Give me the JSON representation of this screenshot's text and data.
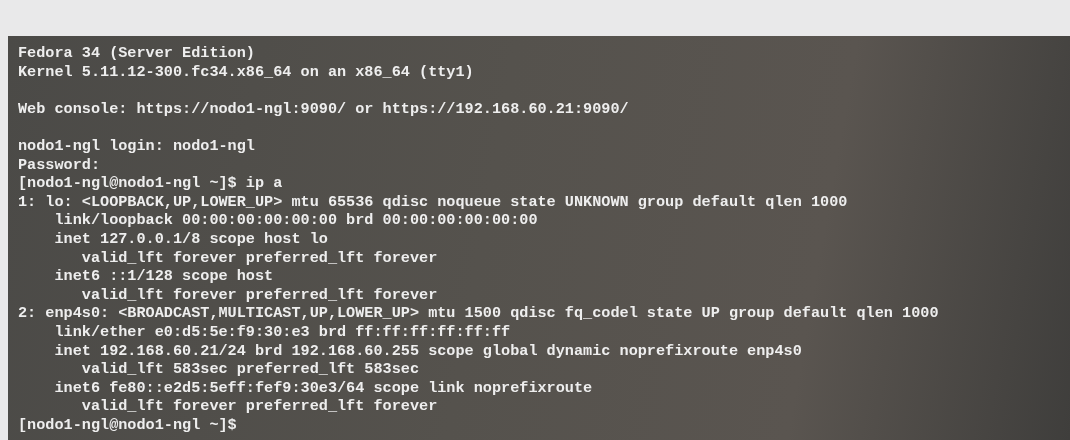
{
  "console": {
    "blocks": [
      {
        "lines": [
          "Fedora 34 (Server Edition)",
          "Kernel 5.11.12-300.fc34.x86_64 on an x86_64 (tty1)"
        ]
      },
      {
        "lines": [
          "Web console: https://nodo1-ngl:9090/ or https://192.168.60.21:9090/"
        ]
      },
      {
        "lines": [
          "nodo1-ngl login: nodo1-ngl",
          "Password:",
          "[nodo1-ngl@nodo1-ngl ~]$ ip a",
          "1: lo: <LOOPBACK,UP,LOWER_UP> mtu 65536 qdisc noqueue state UNKNOWN group default qlen 1000",
          "    link/loopback 00:00:00:00:00:00 brd 00:00:00:00:00:00",
          "    inet 127.0.0.1/8 scope host lo",
          "       valid_lft forever preferred_lft forever",
          "    inet6 ::1/128 scope host",
          "       valid_lft forever preferred_lft forever",
          "2: enp4s0: <BROADCAST,MULTICAST,UP,LOWER_UP> mtu 1500 qdisc fq_codel state UP group default qlen 1000",
          "    link/ether e0:d5:5e:f9:30:e3 brd ff:ff:ff:ff:ff:ff",
          "    inet 192.168.60.21/24 brd 192.168.60.255 scope global dynamic noprefixroute enp4s0",
          "       valid_lft 583sec preferred_lft 583sec",
          "    inet6 fe80::e2d5:5eff:fef9:30e3/64 scope link noprefixroute",
          "       valid_lft forever preferred_lft forever",
          "[nodo1-ngl@nodo1-ngl ~]$"
        ]
      }
    ]
  }
}
